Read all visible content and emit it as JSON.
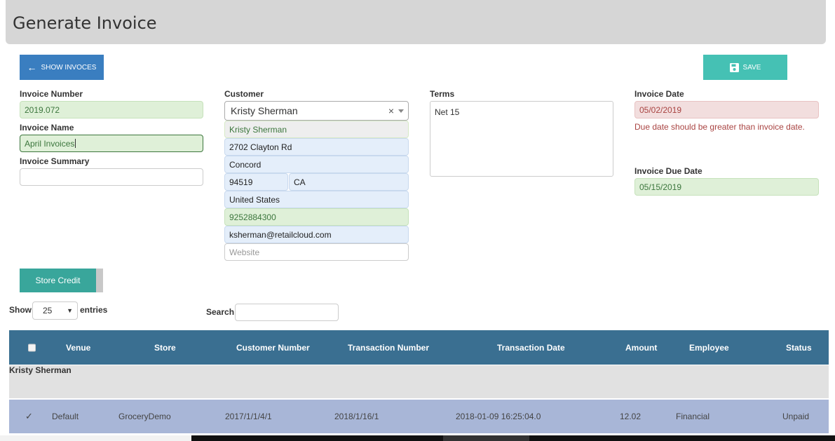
{
  "header": {
    "title": "Generate Invoice"
  },
  "toolbar": {
    "show_invoices_label": "SHOW INVOCES",
    "save_label": "SAVE"
  },
  "invoice": {
    "number_label": "Invoice Number",
    "number_value": "2019.072",
    "name_label": "Invoice Name",
    "name_value": "April Invoices",
    "summary_label": "Invoice Summary",
    "summary_value": ""
  },
  "customer": {
    "label": "Customer",
    "selected": "Kristy Sherman",
    "clear_symbol": "×",
    "name": "Kristy Sherman",
    "address": "2702 Clayton Rd",
    "city": "Concord",
    "zip": "94519",
    "state": "CA",
    "country": "United States",
    "phone": "9252884300",
    "email": "ksherman@retailcloud.com",
    "website_placeholder": "Website"
  },
  "terms": {
    "label": "Terms",
    "value": "Net 15"
  },
  "dates": {
    "invoice_date_label": "Invoice Date",
    "invoice_date_value": "05/02/2019",
    "error_message": "Due date should be greater than invoice date.",
    "due_date_label": "Invoice Due Date",
    "due_date_value": "05/15/2019"
  },
  "store_credit_label": "Store Credit",
  "table_controls": {
    "show_label": "Show",
    "entries_value": "25",
    "entries_label": "entries",
    "search_label": "Search:"
  },
  "table": {
    "columns": [
      "Venue",
      "Store",
      "Customer Number",
      "Transaction Number",
      "Transaction Date",
      "Amount",
      "Employee",
      "Status"
    ],
    "group_label": "Kristy Sherman",
    "rows": [
      {
        "check": "✓",
        "venue": "Default",
        "store": "GroceryDemo",
        "customer_number": "2017/1/1/4/1",
        "transaction_number": "2018/1/16/1",
        "transaction_date": "2018-01-09 16:25:04.0",
        "amount": "12.02",
        "employee": "Financial",
        "status": "Unpaid"
      }
    ]
  },
  "colors": {
    "header_bg": "#d6d6d6",
    "primary_blue": "#3a7ec0",
    "teal": "#45c1b4",
    "store_credit": "#39a69b",
    "table_header": "#3a6f91",
    "selected_row": "#a8b6d7",
    "error": "#a94442"
  }
}
